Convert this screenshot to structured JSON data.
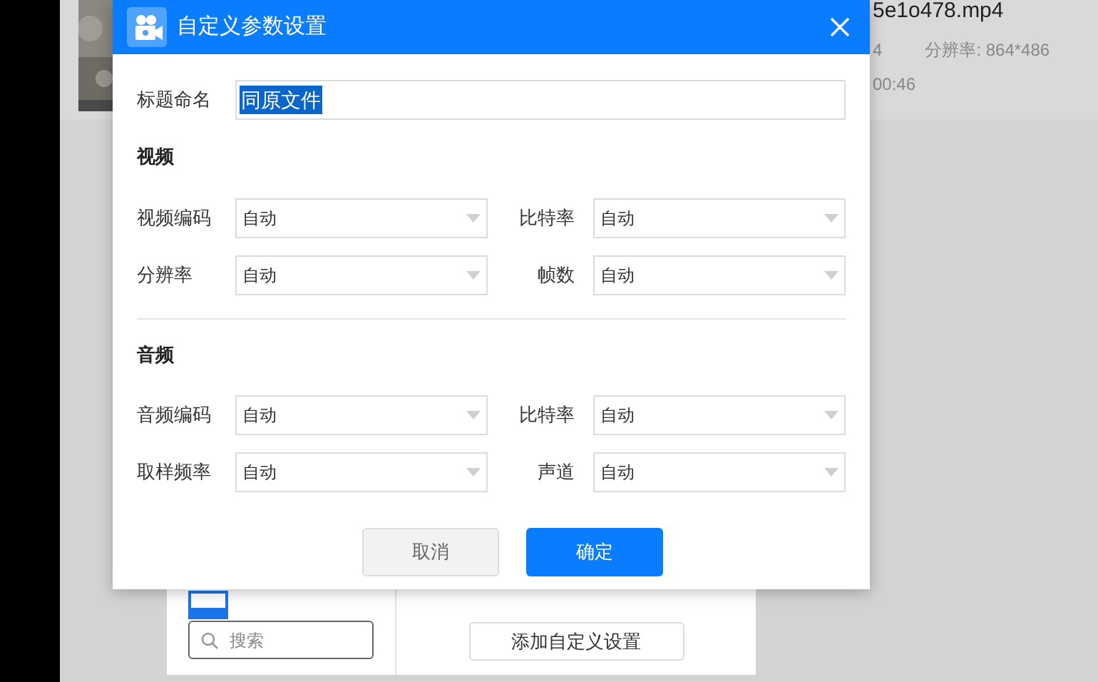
{
  "background": {
    "file_name": "5e1o478.mp4",
    "info_1": "4",
    "resolution": "分辨率: 864*486",
    "duration": "00:46",
    "search": {
      "placeholder": "搜索"
    },
    "add_button": "添加自定义设置"
  },
  "dialog": {
    "title": "自定义参数设置",
    "title_field": {
      "label": "标题命名",
      "value": "同原文件",
      "selected": true
    },
    "sections": [
      {
        "title": "视频",
        "fields": [
          {
            "label": "视频编码",
            "value": "自动"
          },
          {
            "label": "比特率",
            "value": "自动"
          },
          {
            "label": "分辨率",
            "value": "自动"
          },
          {
            "label": "帧数",
            "value": "自动"
          }
        ]
      },
      {
        "title": "音频",
        "fields": [
          {
            "label": "音频编码",
            "value": "自动"
          },
          {
            "label": "比特率",
            "value": "自动"
          },
          {
            "label": "取样频率",
            "value": "自动"
          },
          {
            "label": "声道",
            "value": "自动"
          }
        ]
      }
    ],
    "buttons": [
      {
        "label": "取消",
        "kind": "secondary"
      },
      {
        "label": "确定",
        "kind": "primary"
      }
    ]
  }
}
